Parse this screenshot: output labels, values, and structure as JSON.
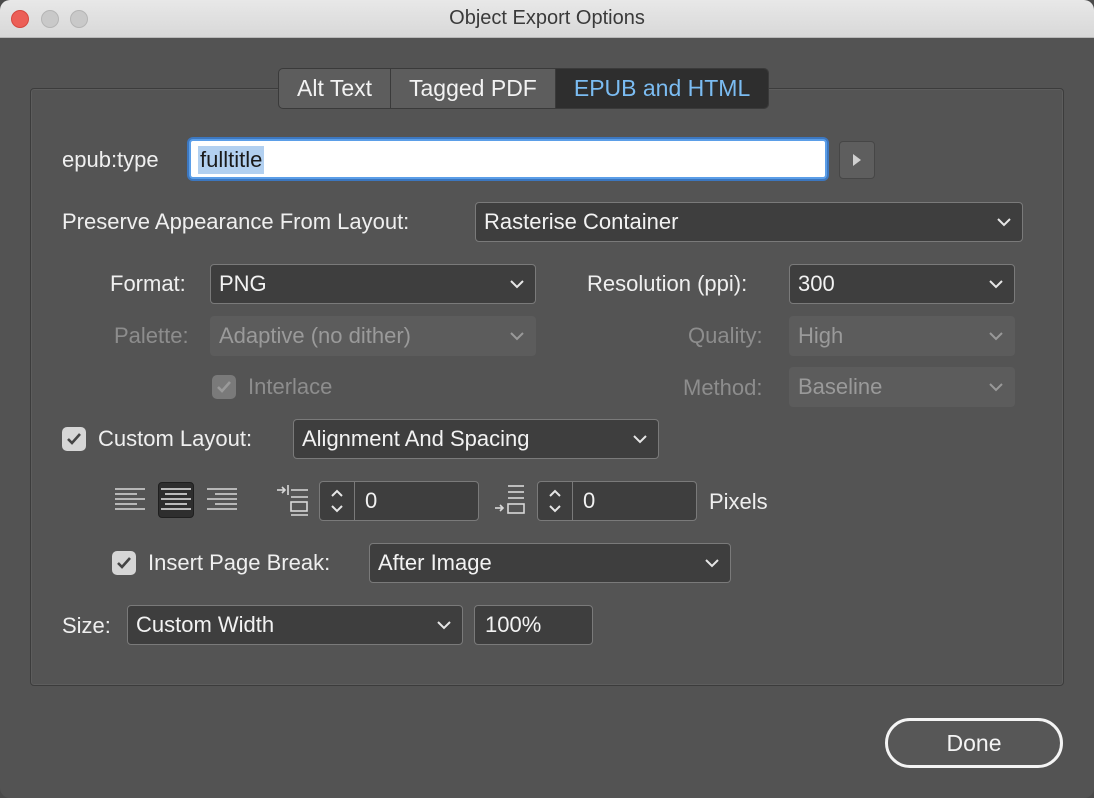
{
  "window": {
    "title": "Object Export Options"
  },
  "tabs": [
    {
      "label": "Alt Text",
      "active": false
    },
    {
      "label": "Tagged PDF",
      "active": false
    },
    {
      "label": "EPUB and HTML",
      "active": true
    }
  ],
  "epub": {
    "label": "epub:type",
    "value": "fulltitle"
  },
  "preserve": {
    "label": "Preserve Appearance From Layout:",
    "value": "Rasterise Container"
  },
  "format": {
    "label": "Format:",
    "value": "PNG"
  },
  "resolution": {
    "label": "Resolution (ppi):",
    "value": "300"
  },
  "palette": {
    "label": "Palette:",
    "value": "Adaptive (no dither)",
    "enabled": false
  },
  "quality": {
    "label": "Quality:",
    "value": "High",
    "enabled": false
  },
  "interlace": {
    "label": "Interlace",
    "checked": true,
    "enabled": false
  },
  "method": {
    "label": "Method:",
    "value": "Baseline",
    "enabled": false
  },
  "custom_layout": {
    "label": "Custom Layout:",
    "checked": true,
    "value": "Alignment And Spacing"
  },
  "alignment": {
    "options": [
      "align-left",
      "align-center",
      "align-right"
    ],
    "selected": "align-center"
  },
  "space_before": {
    "value": "0"
  },
  "space_after": {
    "value": "0"
  },
  "units_label": "Pixels",
  "page_break": {
    "label": "Insert Page Break:",
    "checked": true,
    "value": "After Image"
  },
  "size": {
    "label": "Size:",
    "value": "Custom Width",
    "percent": "100%"
  },
  "done_label": "Done",
  "colors": {
    "accent": "#7bbcf2",
    "focus_ring": "#5b9ee8",
    "selection": "#b2d0f0",
    "close": "#ec5f57"
  }
}
